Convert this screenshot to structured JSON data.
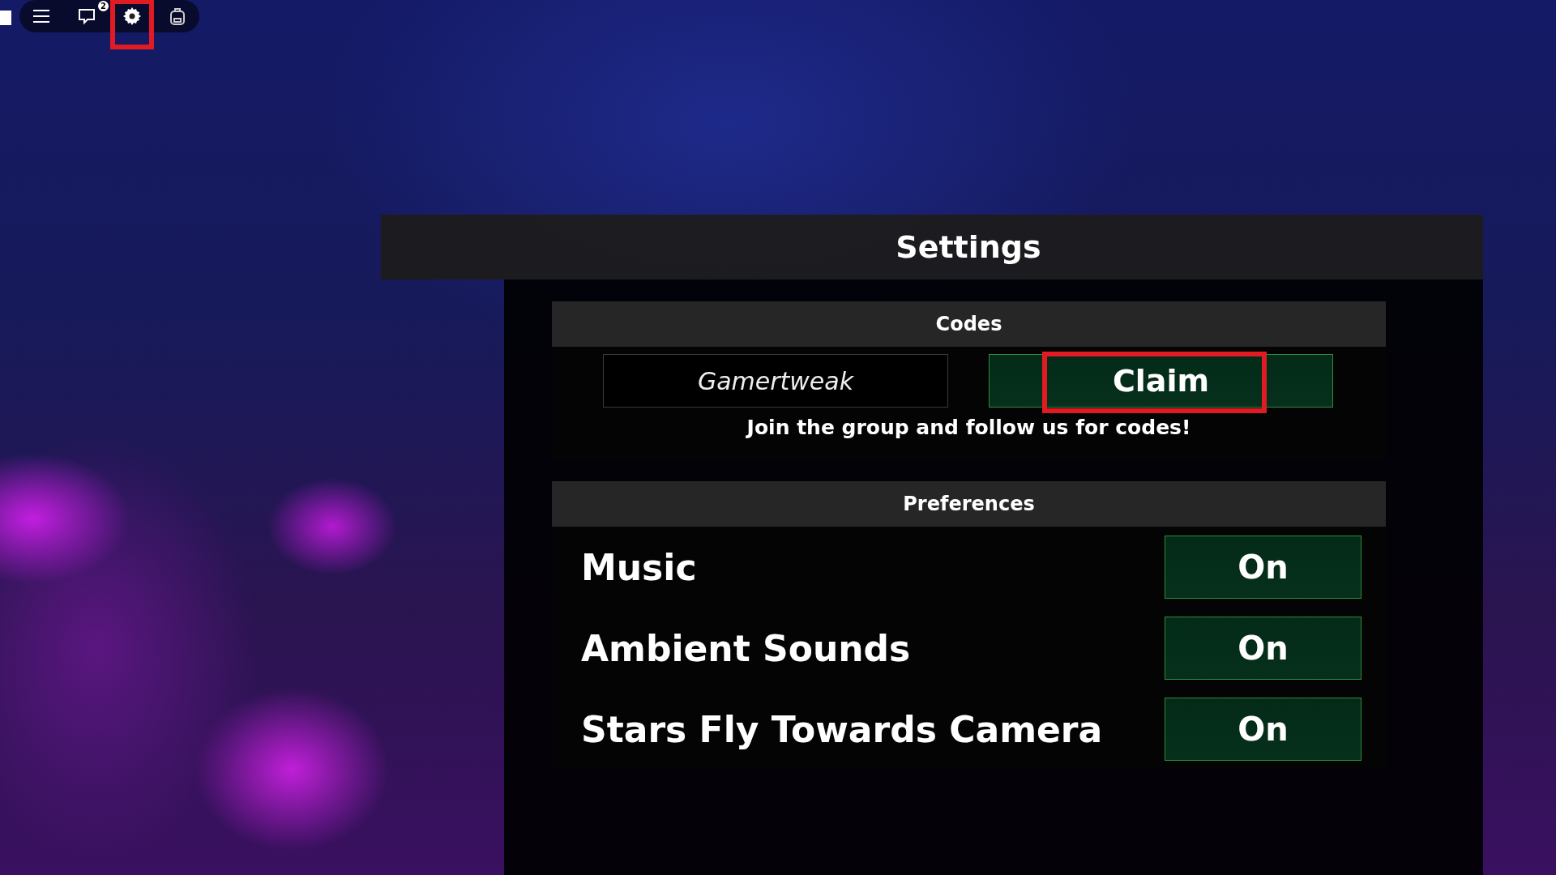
{
  "top_bar": {
    "chat_badge": "2",
    "settings_highlighted": true
  },
  "settings": {
    "title": "Settings",
    "codes": {
      "heading": "Codes",
      "code_value": "Gamertweak",
      "claim_label": "Claim",
      "claim_highlighted": true,
      "hint": "Join the group and follow us for codes!"
    },
    "preferences": {
      "heading": "Preferences",
      "items": [
        {
          "label": "Music",
          "state_label": "On",
          "on": true
        },
        {
          "label": "Ambient Sounds",
          "state_label": "On",
          "on": true
        },
        {
          "label": "Stars Fly Towards Camera",
          "state_label": "On",
          "on": true
        }
      ]
    }
  }
}
